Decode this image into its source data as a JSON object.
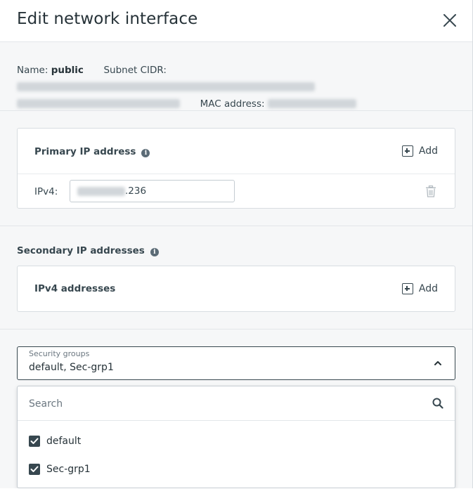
{
  "dialog": {
    "title": "Edit network interface"
  },
  "info": {
    "name_label": "Name:",
    "name_value": "public",
    "subnet_label": "Subnet CIDR:",
    "mac_label": "MAC address:"
  },
  "primary": {
    "title": "Primary IP address",
    "add_label": "Add",
    "ipv4_label": "IPv4:",
    "ipv4_value_visible": ".236"
  },
  "secondary": {
    "title": "Secondary IP addresses",
    "card_title": "IPv4 addresses",
    "add_label": "Add"
  },
  "security_groups": {
    "label": "Security groups",
    "value": "default, Sec-grp1",
    "search_placeholder": "Search",
    "options": [
      {
        "label": "default",
        "checked": true
      },
      {
        "label": "Sec-grp1",
        "checked": true
      }
    ]
  },
  "colors": {
    "text_dark": "#263238",
    "checkbox": "#37474f",
    "panel_bg": "#f6f7f8"
  }
}
